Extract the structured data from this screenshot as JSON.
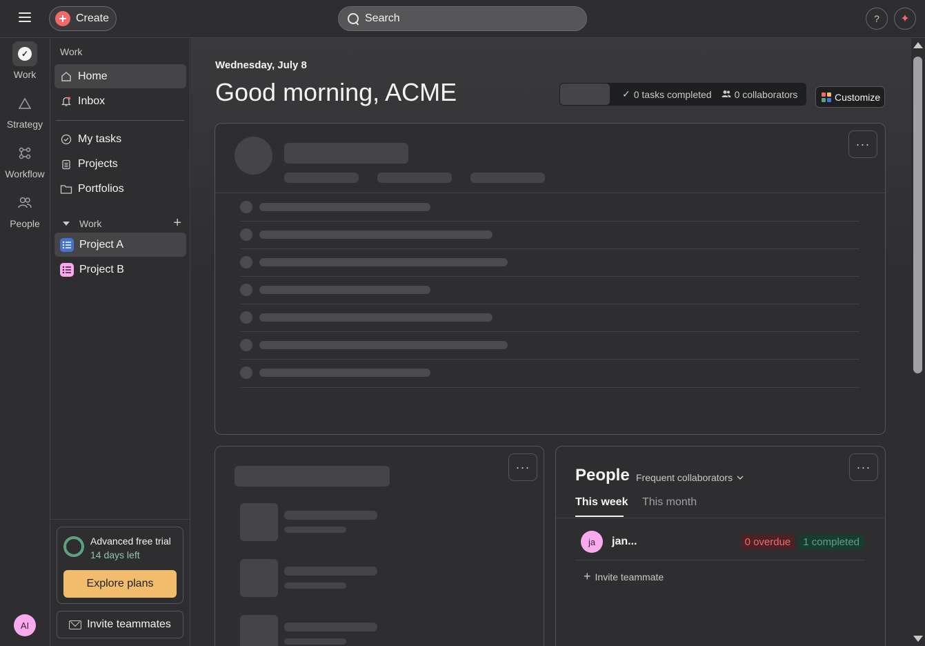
{
  "topbar": {
    "create_label": "Create",
    "search_placeholder": "Search",
    "help_label": "?",
    "ai_label": "✦"
  },
  "rail": {
    "items": [
      {
        "label": "Work",
        "icon": "check-circle-icon"
      },
      {
        "label": "Strategy",
        "icon": "triangle-icon"
      },
      {
        "label": "Workflow",
        "icon": "workflow-icon"
      },
      {
        "label": "People",
        "icon": "people-icon"
      }
    ],
    "avatar_initials": "AI"
  },
  "sidebar": {
    "heading": "Work",
    "nav": [
      {
        "label": "Home",
        "icon": "home-icon"
      },
      {
        "label": "Inbox",
        "icon": "bell-icon"
      },
      {
        "label": "My tasks",
        "icon": "check-circle-icon"
      },
      {
        "label": "Projects",
        "icon": "clipboard-icon"
      },
      {
        "label": "Portfolios",
        "icon": "folder-icon"
      }
    ],
    "section_label": "Work",
    "projects": [
      {
        "label": "Project A",
        "color": "#4573d2"
      },
      {
        "label": "Project B",
        "color": "#f9aaef"
      }
    ],
    "trial": {
      "title": "Advanced free trial",
      "subtitle": "14 days left",
      "button": "Explore plans"
    },
    "invite_label": "Invite teammates"
  },
  "main": {
    "date": "Wednesday, July 8",
    "greeting": "Good morning, ACME",
    "stats": {
      "tasks_completed": "0 tasks completed",
      "collaborators": "0 collaborators"
    },
    "customize_label": "Customize",
    "people": {
      "title": "People",
      "filter": "Frequent collaborators",
      "tabs": [
        "This week",
        "This month"
      ],
      "person": {
        "initials": "ja",
        "name": "jan...",
        "overdue": "0 overdue",
        "completed": "1 completed"
      },
      "invite_label": "Invite teammate"
    }
  },
  "colors": {
    "accent_red": "#f06a6a",
    "trial_yellow": "#f1bd6c",
    "success_green": "#5da283"
  }
}
